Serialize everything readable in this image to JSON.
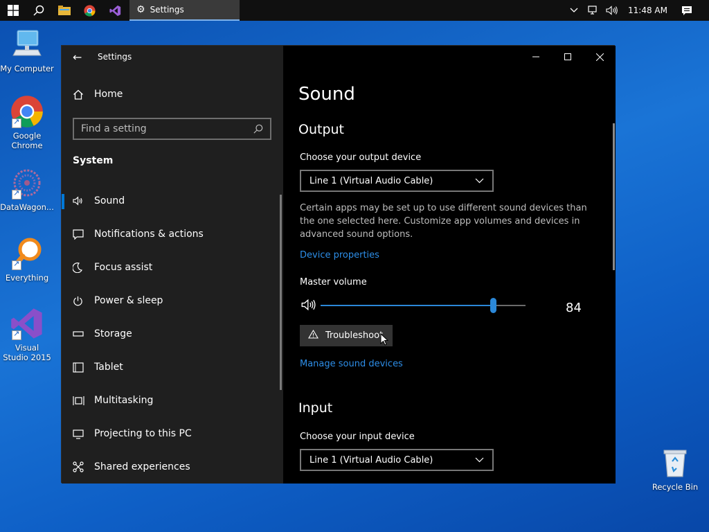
{
  "taskbar": {
    "active_app": "Settings",
    "clock": "11:48 AM"
  },
  "desktop": {
    "icons": [
      {
        "label": "My Computer"
      },
      {
        "label": "Google Chrome"
      },
      {
        "label": "DataWagon..."
      },
      {
        "label": "Everything"
      },
      {
        "label": "Visual Studio 2015"
      },
      {
        "label": "Recycle Bin"
      }
    ]
  },
  "window": {
    "title": "Settings",
    "sidebar": {
      "home_label": "Home",
      "search_placeholder": "Find a setting",
      "section": "System",
      "items": [
        {
          "label": "Sound",
          "icon": "speaker-icon"
        },
        {
          "label": "Notifications & actions",
          "icon": "notification-icon"
        },
        {
          "label": "Focus assist",
          "icon": "moon-icon"
        },
        {
          "label": "Power & sleep",
          "icon": "power-icon"
        },
        {
          "label": "Storage",
          "icon": "storage-icon"
        },
        {
          "label": "Tablet",
          "icon": "tablet-icon"
        },
        {
          "label": "Multitasking",
          "icon": "multitasking-icon"
        },
        {
          "label": "Projecting to this PC",
          "icon": "projecting-icon"
        },
        {
          "label": "Shared experiences",
          "icon": "shared-icon"
        }
      ]
    },
    "content": {
      "page_title": "Sound",
      "output": {
        "heading": "Output",
        "device_label": "Choose your output device",
        "device_value": "Line 1 (Virtual Audio Cable)",
        "description": "Certain apps may be set up to use different sound devices than the one selected here. Customize app volumes and devices in advanced sound options.",
        "device_properties_link": "Device properties",
        "master_volume_label": "Master volume",
        "volume": 84,
        "volume_text": "84",
        "troubleshoot_label": "Troubleshoot",
        "manage_link": "Manage sound devices"
      },
      "input": {
        "heading": "Input",
        "device_label": "Choose your input device",
        "device_value": "Line 1 (Virtual Audio Cable)"
      }
    }
  },
  "colors": {
    "accent": "#0078d7",
    "link": "#2d8ee8",
    "sidebar_bg": "#1f1f1f",
    "content_bg": "#000000"
  }
}
